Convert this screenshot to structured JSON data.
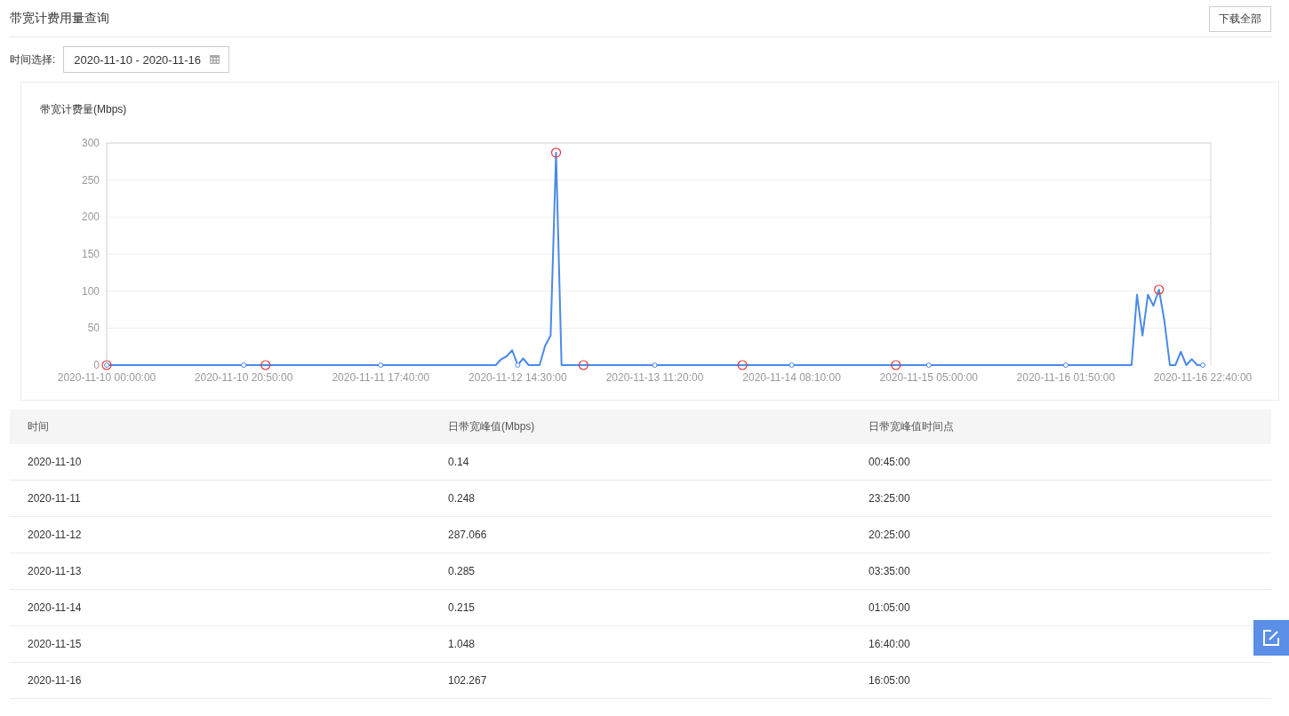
{
  "page_title": "带宽计费用量查询",
  "download_button": "下载全部",
  "date_filter": {
    "label": "时间选择:",
    "value": "2020-11-10 - 2020-11-16"
  },
  "chart": {
    "chart_data": {
      "type": "line",
      "grid": true,
      "title": "带宽计费量(Mbps)",
      "ylim": [
        0,
        300
      ],
      "yticks": [
        0,
        50,
        100,
        150,
        200,
        250,
        300
      ],
      "categories": [
        "2020-11-10 00:00:00",
        null,
        null,
        null,
        null,
        null,
        null,
        null,
        null,
        null,
        null,
        null,
        null,
        null,
        null,
        null,
        null,
        null,
        null,
        null,
        null,
        null,
        null,
        null,
        null,
        "2020-11-10 20:50:00",
        null,
        null,
        null,
        null,
        null,
        null,
        null,
        null,
        null,
        null,
        null,
        null,
        null,
        null,
        null,
        null,
        null,
        null,
        null,
        null,
        null,
        null,
        null,
        null,
        "2020-11-11 17:40:00",
        null,
        null,
        null,
        null,
        null,
        null,
        null,
        null,
        null,
        null,
        null,
        null,
        null,
        null,
        null,
        null,
        null,
        null,
        null,
        null,
        null,
        null,
        null,
        null,
        "2020-11-12 14:30:00",
        null,
        null,
        null,
        null,
        null,
        null,
        null,
        null,
        null,
        null,
        null,
        null,
        null,
        null,
        null,
        null,
        null,
        null,
        null,
        null,
        null,
        null,
        null,
        null,
        "2020-11-13 11:20:00",
        null,
        null,
        null,
        null,
        null,
        null,
        null,
        null,
        null,
        null,
        null,
        null,
        null,
        null,
        null,
        null,
        null,
        null,
        null,
        null,
        null,
        null,
        null,
        null,
        "2020-11-14 08:10:00",
        null,
        null,
        null,
        null,
        null,
        null,
        null,
        null,
        null,
        null,
        null,
        null,
        null,
        null,
        null,
        null,
        null,
        null,
        null,
        null,
        null,
        null,
        null,
        null,
        "2020-11-15 05:00:00",
        null,
        null,
        null,
        null,
        null,
        null,
        null,
        null,
        null,
        null,
        null,
        null,
        null,
        null,
        null,
        null,
        null,
        null,
        null,
        null,
        null,
        null,
        null,
        null,
        "2020-11-16 01:50:00",
        null,
        null,
        null,
        null,
        null,
        null,
        null,
        null,
        null,
        null,
        null,
        null,
        null,
        null,
        null,
        null,
        null,
        null,
        null,
        null,
        null,
        null,
        null,
        null,
        "2020-11-16 22:40:00"
      ],
      "series": [
        {
          "color": "#4a8ae8",
          "values": [
            0,
            0,
            0,
            0,
            0,
            0,
            0,
            0,
            0,
            0,
            0,
            0,
            0,
            0,
            0,
            0,
            0,
            0,
            0,
            0,
            0,
            0,
            0,
            0,
            0,
            0,
            0,
            0,
            0,
            0,
            0,
            0,
            0,
            0,
            0,
            0,
            0,
            0,
            0,
            0,
            0,
            0,
            0,
            0,
            0,
            0,
            0,
            0,
            0,
            0,
            0,
            0,
            0,
            0,
            0,
            0,
            0,
            0,
            0,
            0,
            0,
            0,
            0,
            0,
            0,
            0,
            0,
            0,
            0,
            0,
            0,
            0,
            8,
            12,
            20,
            0,
            9,
            0,
            0,
            0,
            26,
            40,
            287,
            0,
            0,
            0,
            0,
            0,
            0,
            0,
            0,
            0,
            0,
            0,
            0,
            0,
            0,
            0,
            0,
            0,
            0,
            0,
            0,
            0,
            0,
            0,
            0,
            0,
            0,
            0,
            0,
            0,
            0,
            0,
            0,
            0,
            0,
            0,
            0,
            0,
            0,
            0,
            0,
            0,
            0,
            0,
            0,
            0,
            0,
            0,
            0,
            0,
            0,
            0,
            0,
            0,
            0,
            0,
            0,
            0,
            0,
            0,
            0,
            0,
            0,
            0,
            0,
            0,
            0,
            0,
            0,
            0,
            0,
            0,
            0,
            0,
            0,
            0,
            0,
            0,
            0,
            0,
            0,
            0,
            0,
            0,
            0,
            0,
            0,
            0,
            0,
            0,
            0,
            0,
            0,
            0,
            0,
            0,
            0,
            0,
            0,
            0,
            0,
            0,
            0,
            0,
            0,
            0,
            95,
            40,
            95,
            80,
            102,
            60,
            0,
            0,
            18,
            0,
            8,
            0,
            0
          ]
        }
      ]
    }
  },
  "table": {
    "columns": [
      "时间",
      "日带宽峰值(Mbps)",
      "日带宽峰值时间点"
    ],
    "rows": [
      [
        "2020-11-10",
        "0.14",
        "00:45:00"
      ],
      [
        "2020-11-11",
        "0.248",
        "23:25:00"
      ],
      [
        "2020-11-12",
        "287.066",
        "20:25:00"
      ],
      [
        "2020-11-13",
        "0.285",
        "03:35:00"
      ],
      [
        "2020-11-14",
        "0.215",
        "01:05:00"
      ],
      [
        "2020-11-15",
        "1.048",
        "16:40:00"
      ],
      [
        "2020-11-16",
        "102.267",
        "16:05:00"
      ]
    ]
  }
}
